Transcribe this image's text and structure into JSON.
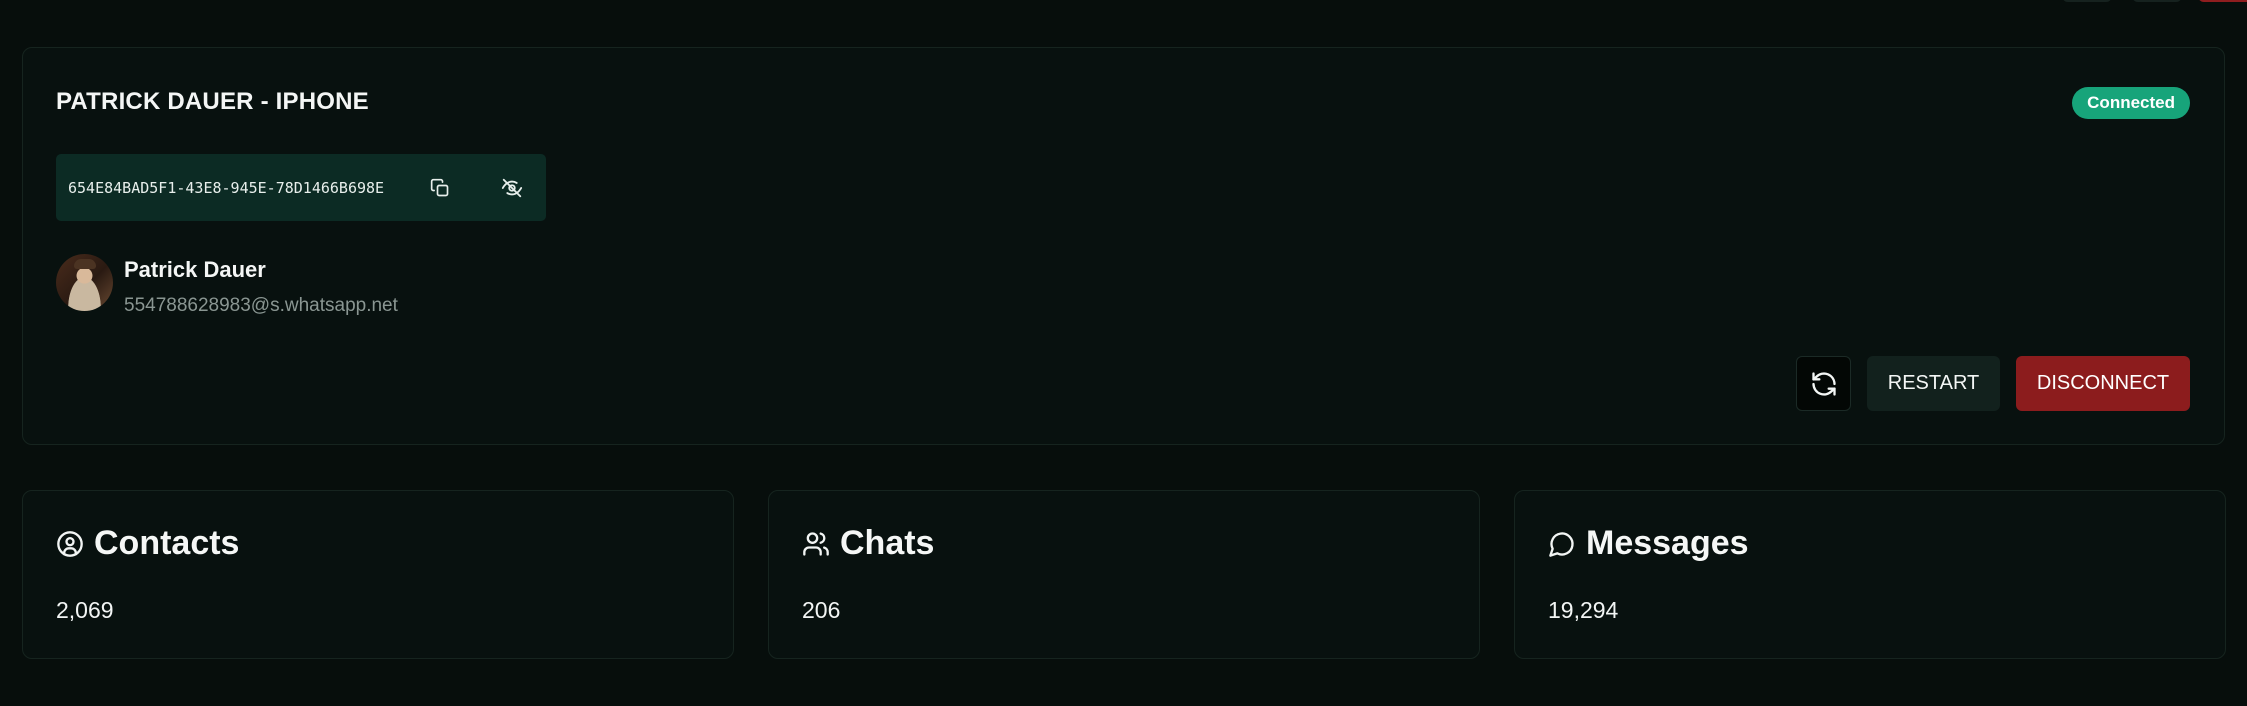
{
  "instance": {
    "name": "PATRICK DAUER - IPHONE",
    "status": "Connected",
    "status_color": "#17a47a",
    "token": "654E84BAD5F1-43E8-945E-78D1466B698E",
    "token_actions": [
      "copy-icon",
      "eye-off-icon"
    ],
    "profile": {
      "name": "Patrick Dauer",
      "jid": "554788628983@s.whatsapp.net"
    },
    "actions": {
      "refresh_icon": "refresh-icon",
      "restart_label": "RESTART",
      "disconnect_label": "DISCONNECT",
      "disconnect_color": "#8c1c1d"
    }
  },
  "stats": [
    {
      "icon": "user-circle-icon",
      "label": "Contacts",
      "value": "2,069"
    },
    {
      "icon": "users-icon",
      "label": "Chats",
      "value": "206"
    },
    {
      "icon": "message-circle-icon",
      "label": "Messages",
      "value": "19,294"
    }
  ]
}
